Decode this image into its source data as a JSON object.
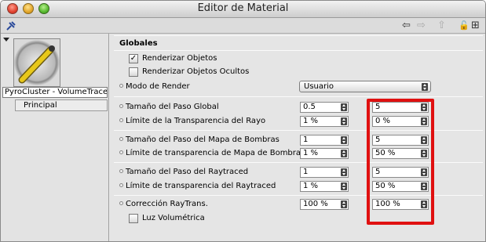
{
  "window": {
    "title": "Editor de Material"
  },
  "toolbar": {
    "pin_icon": "pin-icon",
    "back": "⇦",
    "forward": "⇨",
    "up": "⇧",
    "lock": "🔓",
    "new_window": "⊞"
  },
  "left_panel": {
    "object_name": "PyroCluster - VolumeTracer",
    "tab": "Principal"
  },
  "section": {
    "title": "Globales"
  },
  "checkboxes": [
    {
      "label": "Renderizar Objetos",
      "checked": true
    },
    {
      "label": "Renderizar Objetos Ocultos",
      "checked": false
    }
  ],
  "render_mode": {
    "label": "Modo de Render",
    "value": "Usuario"
  },
  "rows": [
    {
      "label": "Tamaño del Paso Global",
      "value1": "0.5",
      "value2": "5"
    },
    {
      "label": "Límite de la Transparencia del Rayo",
      "value1": "1 %",
      "value2": "0 %"
    },
    {
      "label": "Tamaño del Paso del Mapa de Bombras",
      "value1": "1",
      "value2": "5"
    },
    {
      "label": "Límite de transparencia de Mapa de Bombras",
      "value1": "1 %",
      "value2": "50 %"
    },
    {
      "label": "Tamaño del Paso del Raytraced",
      "value1": "1",
      "value2": "5"
    },
    {
      "label": "Límite de transparencia del Raytraced",
      "value1": "1 %",
      "value2": "50 %"
    },
    {
      "label": "Corrección RayTrans.",
      "value1": "100 %",
      "value2": "100 %"
    }
  ],
  "volumetric": {
    "label": "Luz Volumétrica",
    "checked": false
  },
  "highlight_color": "#e01010"
}
